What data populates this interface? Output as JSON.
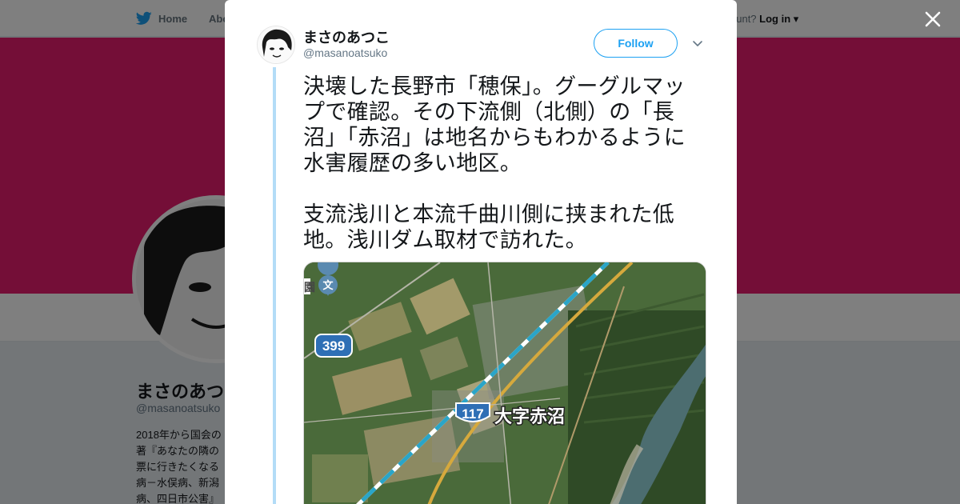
{
  "nav": {
    "home": "Home",
    "about": "Abo",
    "account_prompt": "ccount?",
    "login": "Log in"
  },
  "profile": {
    "name": "まさのあつこ",
    "handle": "@masanoatsuko",
    "bio_lines": [
      "2018年から国会の",
      "著『あなたの隣の",
      "票に行きたくなる",
      "病－水俣病、新潟",
      "病、四日市公害』"
    ]
  },
  "tweet": {
    "author_name": "まさのあつこ",
    "author_handle": "@masanoatsuko",
    "follow_label": "Follow",
    "text_lines": [
      "決壊した長野市「穂保」。グーグルマッ",
      "プで確認。その下流側（北側）の「長",
      "沼」「赤沼」は地名からもわかるように",
      "水害履歴の多い地区。",
      "",
      "支流浅川と本流千曲川側に挟まれた低",
      "地。浅川ダム取材で訪れた。"
    ],
    "media": {
      "route_399": "399",
      "route_117": "117",
      "place_label": "大字赤沼",
      "school_marker": "文",
      "edge_label": "園"
    }
  },
  "colors": {
    "brand_blue": "#1da1f2",
    "banner_pink": "#e81c6f",
    "thread_line": "#b3dcf7"
  },
  "icons": {
    "close": "close-icon",
    "caret": "chevron-down-icon",
    "bird": "twitter-bird-icon"
  }
}
